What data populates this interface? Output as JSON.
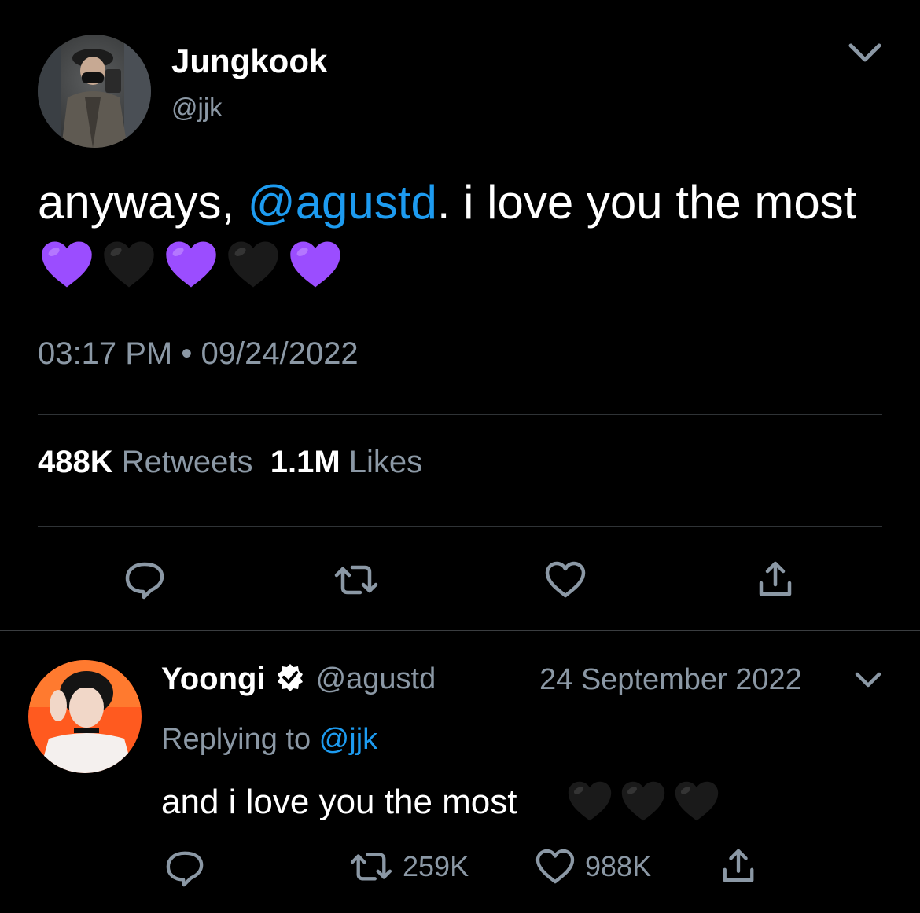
{
  "main_tweet": {
    "author_name": "Jungkook",
    "author_handle": "@jjk",
    "text_before": "anyways, ",
    "mention": "@agustd",
    "text_after": ". i love you the most",
    "emoji_hearts": [
      "purple",
      "black",
      "purple",
      "black",
      "purple"
    ],
    "time": "03:17 PM",
    "separator": "•",
    "date": "09/24/2022",
    "retweets_count": "488K",
    "retweets_label": "Retweets",
    "likes_count": "1.1M",
    "likes_label": "Likes",
    "actions": [
      "reply-icon",
      "retweet-icon",
      "like-icon",
      "share-icon"
    ]
  },
  "reply_tweet": {
    "author_name": "Yoongi",
    "verified": true,
    "author_handle": "@agustd",
    "date": "24 September 2022",
    "replying_prefix": "Replying to ",
    "replying_handle": "@jjk",
    "text": "and i love you the most",
    "emoji_hearts": [
      "black",
      "black",
      "black"
    ],
    "retweets_count": "259K",
    "likes_count": "988K",
    "actions": [
      "reply-icon",
      "retweet-icon",
      "like-icon",
      "share-icon"
    ]
  },
  "colors": {
    "background": "#000000",
    "text": "#ffffff",
    "secondary": "#8b98a5",
    "link": "#1d9bf0",
    "divider": "#2f3336",
    "purple_heart": "#9b4dff",
    "black_heart": "#1a1a1a"
  }
}
